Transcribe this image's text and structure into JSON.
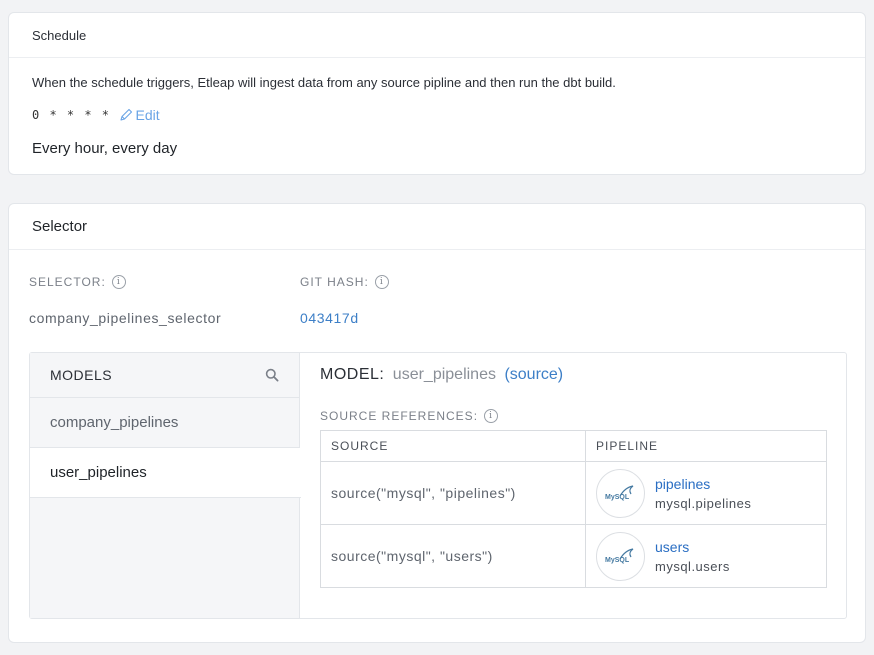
{
  "schedule": {
    "title": "Schedule",
    "description": "When the schedule triggers, Etleap will ingest data from any source pipline and then run the dbt build.",
    "cron": "0 * * * *",
    "edit_label": "Edit",
    "human_readable": "Every hour, every day"
  },
  "selector": {
    "title": "Selector",
    "selector_label": "SELECTOR:",
    "git_hash_label": "GIT HASH:",
    "selector_value": "company_pipelines_selector",
    "git_hash_value": "043417d",
    "info_glyph": "i"
  },
  "models": {
    "header": "MODELS",
    "items": [
      {
        "label": "company_pipelines",
        "active": false
      },
      {
        "label": "user_pipelines",
        "active": true
      }
    ]
  },
  "model_detail": {
    "label": "MODEL:",
    "name": "user_pipelines",
    "source_link": "(source)",
    "refs_label": "SOURCE REFERENCES:",
    "columns": [
      "SOURCE",
      "PIPELINE"
    ],
    "rows": [
      {
        "source": "source(\"mysql\", \"pipelines\")",
        "pipeline_name": "pipelines",
        "pipeline_table": "mysql.pipelines",
        "logo_text": "MySQL"
      },
      {
        "source": "source(\"mysql\", \"users\")",
        "pipeline_name": "users",
        "pipeline_table": "mysql.users",
        "logo_text": "MySQL"
      }
    ]
  },
  "colors": {
    "link": "#3d7fc7",
    "edit": "#6aa4e6",
    "background": "#f2f3f5"
  },
  "icons": [
    "pencil-icon",
    "search-icon",
    "info-icon",
    "mysql-logo-icon"
  ]
}
